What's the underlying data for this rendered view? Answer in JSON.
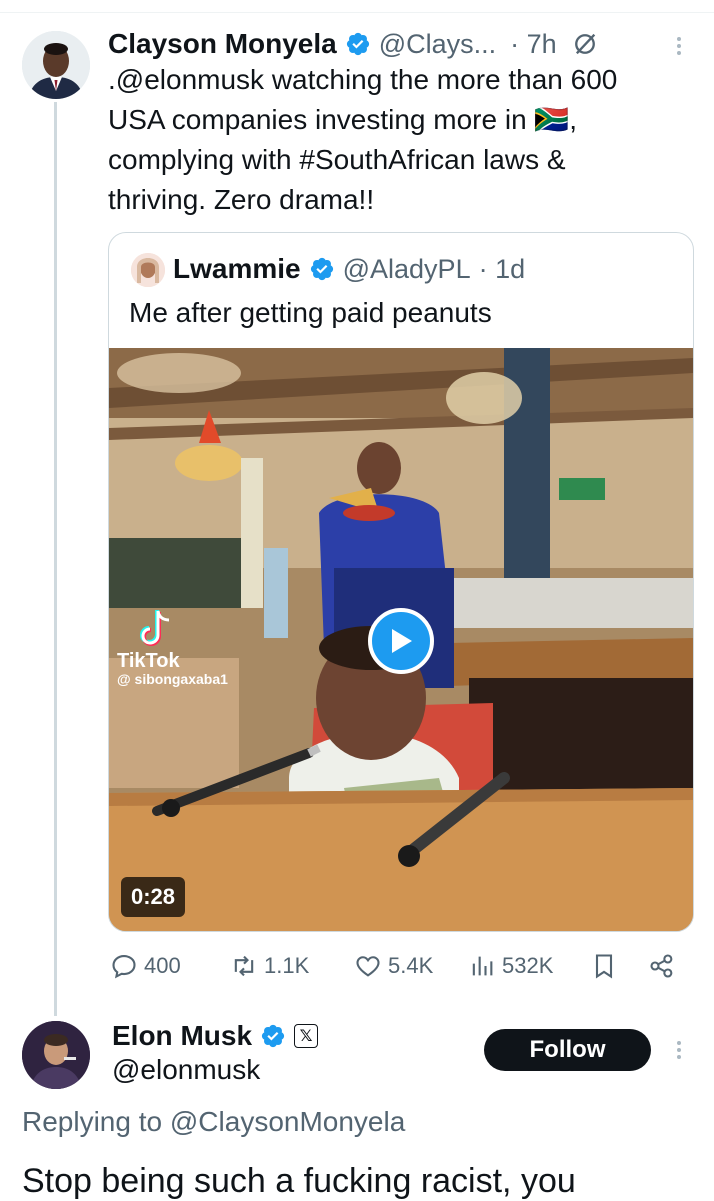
{
  "tweet": {
    "author_name": "Clayson Monyela",
    "author_handle": "@Clays...",
    "time": "· 7h",
    "text": ".@elonmusk watching the more than 600 USA companies investing more in 🇿🇦, complying with #SouthAfrican laws & thriving. Zero drama!!",
    "text_lines": [
      ".@elonmusk watching the more than 600",
      "USA companies investing more in 🇿🇦,",
      "complying with #SouthAfrican laws &",
      "thriving. Zero drama!!"
    ]
  },
  "quote": {
    "author_name": "Lwammie",
    "author_handle": "@AladyPL",
    "time": "· 1d",
    "text": "Me after getting paid peanuts",
    "video_duration": "0:28",
    "watermark_brand": "TikTok",
    "watermark_user": "@ sibongaxaba1"
  },
  "actions": {
    "replies": "400",
    "reposts": "1.1K",
    "likes": "5.4K",
    "views": "532K"
  },
  "reply": {
    "author_name": "Elon Musk",
    "author_handle": "@elonmusk",
    "affiliation_badge": "𝕏",
    "follow_label": "Follow",
    "replying_to_prefix": "Replying to ",
    "replying_to_handle": "@ClaysonMonyela",
    "text_partial": "Stop being such a fucking racist, you"
  },
  "colors": {
    "verified_blue": "#1d9bf0",
    "text_secondary": "#536471",
    "link_blue": "#1d9bf0",
    "follow_bg": "#0f1419"
  }
}
